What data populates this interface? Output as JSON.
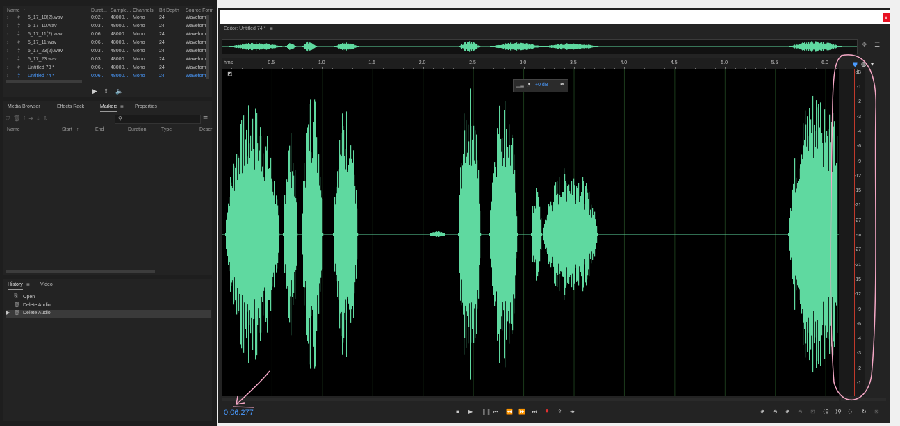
{
  "files": {
    "headers": [
      "Name",
      "Durat...",
      "Sample...",
      "Channels",
      "Bit Depth",
      "Source Form"
    ],
    "rows": [
      {
        "name": "5_17_10(2).wav",
        "dur": "0:02...",
        "rate": "48000...",
        "ch": "Mono",
        "bits": "24",
        "fmt": "Waveform"
      },
      {
        "name": "5_17_10.wav",
        "dur": "0:03...",
        "rate": "48000...",
        "ch": "Mono",
        "bits": "24",
        "fmt": "Waveform"
      },
      {
        "name": "5_17_11(2).wav",
        "dur": "0:06...",
        "rate": "48000...",
        "ch": "Mono",
        "bits": "24",
        "fmt": "Waveform"
      },
      {
        "name": "5_17_11.wav",
        "dur": "0:06...",
        "rate": "48000...",
        "ch": "Mono",
        "bits": "24",
        "fmt": "Waveform"
      },
      {
        "name": "5_17_23(2).wav",
        "dur": "0:03...",
        "rate": "48000...",
        "ch": "Mono",
        "bits": "24",
        "fmt": "Waveform"
      },
      {
        "name": "5_17_23.wav",
        "dur": "0:03...",
        "rate": "48000...",
        "ch": "Mono",
        "bits": "24",
        "fmt": "Waveform"
      },
      {
        "name": "Untitled 73 *",
        "dur": "0:06...",
        "rate": "48000...",
        "ch": "Mono",
        "bits": "24",
        "fmt": "Waveform"
      },
      {
        "name": "Untitled 74 *",
        "dur": "0:06...",
        "rate": "48000...",
        "ch": "Mono",
        "bits": "24",
        "fmt": "Waveform",
        "selected": true
      }
    ]
  },
  "panel_tabs": [
    "Media Browser",
    "Effects Rack",
    "Markers",
    "Properties"
  ],
  "markers": {
    "search_placeholder": "",
    "headers": [
      "Name",
      "Start",
      "End",
      "Duration",
      "Type",
      "Descr"
    ]
  },
  "history": {
    "tabs": [
      "History",
      "Video"
    ],
    "items": [
      "Open",
      "Delete Audio",
      "Delete Audio"
    ]
  },
  "editor": {
    "tab_label": "Editor: Untitled 74 *",
    "hud_gain": "+0 dB",
    "ruler_unit": "hms",
    "ruler_ticks": [
      "0.5",
      "1.0",
      "1.5",
      "2.0",
      "2.5",
      "3.0",
      "3.5",
      "4.0",
      "4.5",
      "5.0",
      "5.5",
      "6.0"
    ],
    "db_unit": "dB",
    "db_labels": [
      "-1",
      "-2",
      "-3",
      "-4",
      "-6",
      "-9",
      "-12",
      "-15",
      "-21",
      "-27",
      "-∞",
      "-27",
      "-21",
      "-15",
      "-12",
      "-9",
      "-6",
      "-4",
      "-3",
      "-2",
      "-1"
    ],
    "timecode": "0:06.277",
    "close_glyph": "x"
  },
  "colors": {
    "waveform": "#5fd9a0",
    "selected_text": "#4a9bff",
    "annotation": "#f4a7c5",
    "record": "#e03030"
  }
}
